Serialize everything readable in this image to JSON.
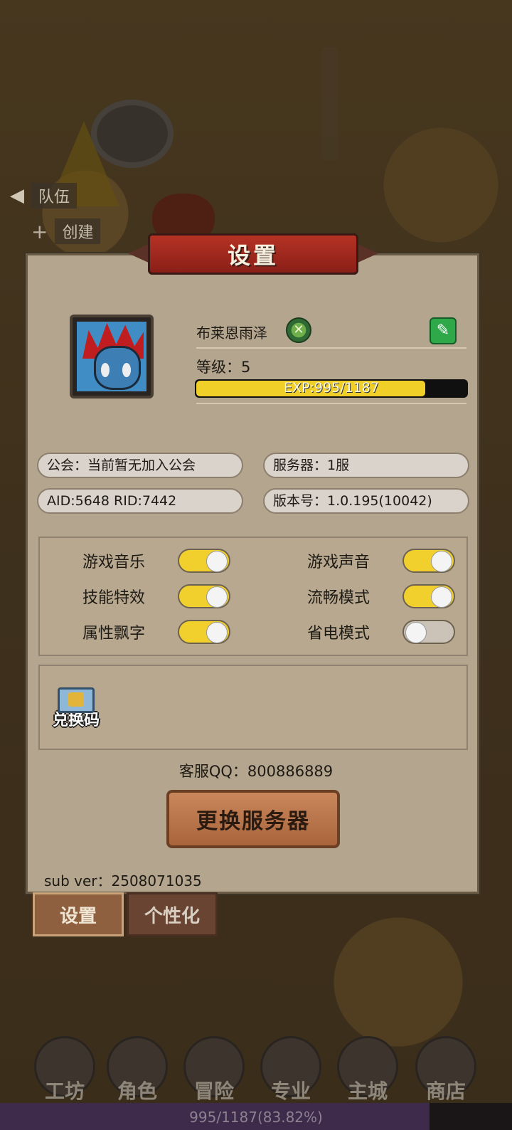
{
  "background": {
    "side_buttons": [
      {
        "label": "队伍",
        "icon": "arrow-left-icon"
      },
      {
        "label": "创建",
        "icon": "plus-icon"
      }
    ],
    "bottom_nav": [
      {
        "label": "工坊"
      },
      {
        "label": "角色"
      },
      {
        "label": "冒险"
      },
      {
        "label": "专业"
      },
      {
        "label": "主城"
      },
      {
        "label": "商店"
      }
    ],
    "xp_bar": {
      "text": "995/1187(83.82%)",
      "progress": 0.8382
    }
  },
  "panel": {
    "title": "设置",
    "player": {
      "name": "布莱恩雨泽",
      "level_label": "等级：",
      "level": "5",
      "exp_text": "EXP:995/1187",
      "exp_progress": 0.8382
    },
    "info": {
      "guild": "公会：当前暂无加入公会",
      "server": "服务器：1服",
      "ids": "AID:5648  RID:7442",
      "version": "版本号：1.0.195(10042)"
    },
    "toggles": [
      {
        "label": "游戏音乐",
        "on": true
      },
      {
        "label": "游戏声音",
        "on": true
      },
      {
        "label": "技能特效",
        "on": true
      },
      {
        "label": "流畅模式",
        "on": true
      },
      {
        "label": "属性飘字",
        "on": true
      },
      {
        "label": "省电模式",
        "on": false
      }
    ],
    "redeem_label": "兑换码",
    "support": "客服QQ：800886889",
    "change_server_label": "更换服务器",
    "sub_ver": "sub ver：2508071035"
  },
  "tabs": {
    "settings": "设置",
    "personalize": "个性化"
  },
  "colors": {
    "accent_yellow": "#f1d02e",
    "panel_bg": "#b4a58e",
    "banner_red": "#b53224",
    "edit_green": "#2fa84a"
  }
}
